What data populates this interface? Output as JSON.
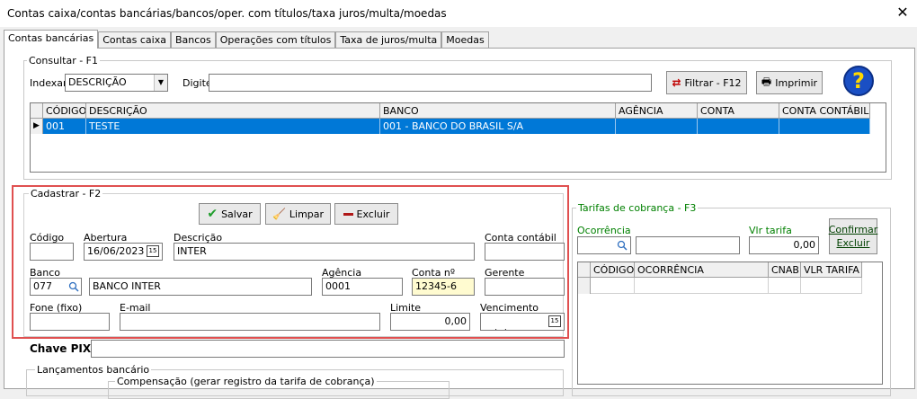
{
  "window": {
    "title": "Contas caixa/contas bancárias/bancos/oper. com títulos/taxa juros/multa/moedas",
    "close": "✕"
  },
  "tabs": [
    "Contas bancárias",
    "Contas caixa",
    "Bancos",
    "Operações com títulos",
    "Taxa de juros/multa",
    "Moedas"
  ],
  "consultar": {
    "title": "Consultar - F1",
    "indexar_label": "Indexar",
    "indexar_value": "DESCRIÇÃO",
    "digite_label": "Digite",
    "digite_value": "",
    "filtrar_label": "Filtrar - F12",
    "imprimir_label": "Imprimir",
    "help": "?"
  },
  "grid": {
    "headers": [
      "CÓDIGO",
      "DESCRIÇÃO",
      "BANCO",
      "AGÊNCIA",
      "CONTA",
      "CONTA CONTÁBIL"
    ],
    "rows": [
      [
        "001",
        "TESTE",
        "001 - BANCO DO BRASIL S/A",
        "",
        "",
        ""
      ]
    ]
  },
  "cadastrar": {
    "title": "Cadastrar - F2",
    "salvar": "Salvar",
    "limpar": "Limpar",
    "excluir": "Excluir",
    "codigo_label": "Código",
    "codigo_value": "",
    "abertura_label": "Abertura",
    "abertura_value": "16/06/2023",
    "descricao_label": "Descrição",
    "descricao_value": "INTER",
    "conta_contabil_label": "Conta contábil",
    "conta_contabil_value": "",
    "banco_label": "Banco",
    "banco_code": "077",
    "banco_name": "BANCO INTER",
    "agencia_label": "Agência",
    "agencia_value": "0001",
    "conta_label": "Conta nº",
    "conta_value": "12345-6",
    "gerente_label": "Gerente",
    "gerente_value": "",
    "fone_label": "Fone (fixo)",
    "fone_value": "",
    "email_label": "E-mail",
    "email_value": "",
    "limite_label": "Limite",
    "limite_value": "0,00",
    "vencimento_label": "Vencimento",
    "vencimento_value": " /  /",
    "cal_icon": "15"
  },
  "chave_pix": {
    "label": "Chave PIX",
    "value": ""
  },
  "lancamentos": {
    "title": "Lançamentos bancário",
    "compensacao": "Compensação (gerar registro da tarifa de cobrança)"
  },
  "tarifas": {
    "title": "Tarifas de cobrança - F3",
    "ocorrencia_label": "Ocorrência",
    "vlr_tarifa_label": "Vlr tarifa",
    "vlr_tarifa_value": "0,00",
    "confirmar": "Confirmar",
    "excluir": "Excluir",
    "headers": [
      "CÓDIGO",
      "OCORRÊNCIA",
      "CNAB",
      "VLR TARIFA"
    ]
  },
  "colors": {
    "selection": "#0078d7",
    "highlight_border": "#e05050",
    "group_label_green": "#008000",
    "help_blue": "#1a4fc4",
    "help_yellow": "#ffd800"
  }
}
